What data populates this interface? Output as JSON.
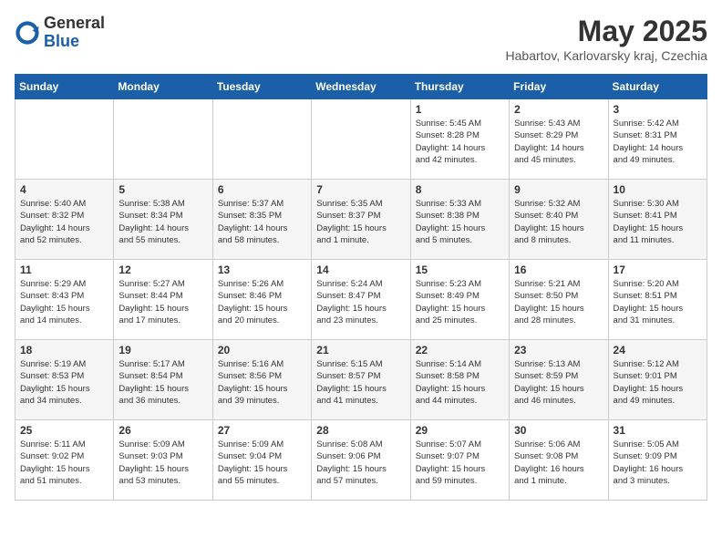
{
  "header": {
    "logo_general": "General",
    "logo_blue": "Blue",
    "month_title": "May 2025",
    "location": "Habartov, Karlovarsky kraj, Czechia"
  },
  "days_of_week": [
    "Sunday",
    "Monday",
    "Tuesday",
    "Wednesday",
    "Thursday",
    "Friday",
    "Saturday"
  ],
  "weeks": [
    [
      {
        "date": "",
        "info": ""
      },
      {
        "date": "",
        "info": ""
      },
      {
        "date": "",
        "info": ""
      },
      {
        "date": "",
        "info": ""
      },
      {
        "date": "1",
        "info": "Sunrise: 5:45 AM\nSunset: 8:28 PM\nDaylight: 14 hours\nand 42 minutes."
      },
      {
        "date": "2",
        "info": "Sunrise: 5:43 AM\nSunset: 8:29 PM\nDaylight: 14 hours\nand 45 minutes."
      },
      {
        "date": "3",
        "info": "Sunrise: 5:42 AM\nSunset: 8:31 PM\nDaylight: 14 hours\nand 49 minutes."
      }
    ],
    [
      {
        "date": "4",
        "info": "Sunrise: 5:40 AM\nSunset: 8:32 PM\nDaylight: 14 hours\nand 52 minutes."
      },
      {
        "date": "5",
        "info": "Sunrise: 5:38 AM\nSunset: 8:34 PM\nDaylight: 14 hours\nand 55 minutes."
      },
      {
        "date": "6",
        "info": "Sunrise: 5:37 AM\nSunset: 8:35 PM\nDaylight: 14 hours\nand 58 minutes."
      },
      {
        "date": "7",
        "info": "Sunrise: 5:35 AM\nSunset: 8:37 PM\nDaylight: 15 hours\nand 1 minute."
      },
      {
        "date": "8",
        "info": "Sunrise: 5:33 AM\nSunset: 8:38 PM\nDaylight: 15 hours\nand 5 minutes."
      },
      {
        "date": "9",
        "info": "Sunrise: 5:32 AM\nSunset: 8:40 PM\nDaylight: 15 hours\nand 8 minutes."
      },
      {
        "date": "10",
        "info": "Sunrise: 5:30 AM\nSunset: 8:41 PM\nDaylight: 15 hours\nand 11 minutes."
      }
    ],
    [
      {
        "date": "11",
        "info": "Sunrise: 5:29 AM\nSunset: 8:43 PM\nDaylight: 15 hours\nand 14 minutes."
      },
      {
        "date": "12",
        "info": "Sunrise: 5:27 AM\nSunset: 8:44 PM\nDaylight: 15 hours\nand 17 minutes."
      },
      {
        "date": "13",
        "info": "Sunrise: 5:26 AM\nSunset: 8:46 PM\nDaylight: 15 hours\nand 20 minutes."
      },
      {
        "date": "14",
        "info": "Sunrise: 5:24 AM\nSunset: 8:47 PM\nDaylight: 15 hours\nand 23 minutes."
      },
      {
        "date": "15",
        "info": "Sunrise: 5:23 AM\nSunset: 8:49 PM\nDaylight: 15 hours\nand 25 minutes."
      },
      {
        "date": "16",
        "info": "Sunrise: 5:21 AM\nSunset: 8:50 PM\nDaylight: 15 hours\nand 28 minutes."
      },
      {
        "date": "17",
        "info": "Sunrise: 5:20 AM\nSunset: 8:51 PM\nDaylight: 15 hours\nand 31 minutes."
      }
    ],
    [
      {
        "date": "18",
        "info": "Sunrise: 5:19 AM\nSunset: 8:53 PM\nDaylight: 15 hours\nand 34 minutes."
      },
      {
        "date": "19",
        "info": "Sunrise: 5:17 AM\nSunset: 8:54 PM\nDaylight: 15 hours\nand 36 minutes."
      },
      {
        "date": "20",
        "info": "Sunrise: 5:16 AM\nSunset: 8:56 PM\nDaylight: 15 hours\nand 39 minutes."
      },
      {
        "date": "21",
        "info": "Sunrise: 5:15 AM\nSunset: 8:57 PM\nDaylight: 15 hours\nand 41 minutes."
      },
      {
        "date": "22",
        "info": "Sunrise: 5:14 AM\nSunset: 8:58 PM\nDaylight: 15 hours\nand 44 minutes."
      },
      {
        "date": "23",
        "info": "Sunrise: 5:13 AM\nSunset: 8:59 PM\nDaylight: 15 hours\nand 46 minutes."
      },
      {
        "date": "24",
        "info": "Sunrise: 5:12 AM\nSunset: 9:01 PM\nDaylight: 15 hours\nand 49 minutes."
      }
    ],
    [
      {
        "date": "25",
        "info": "Sunrise: 5:11 AM\nSunset: 9:02 PM\nDaylight: 15 hours\nand 51 minutes."
      },
      {
        "date": "26",
        "info": "Sunrise: 5:09 AM\nSunset: 9:03 PM\nDaylight: 15 hours\nand 53 minutes."
      },
      {
        "date": "27",
        "info": "Sunrise: 5:09 AM\nSunset: 9:04 PM\nDaylight: 15 hours\nand 55 minutes."
      },
      {
        "date": "28",
        "info": "Sunrise: 5:08 AM\nSunset: 9:06 PM\nDaylight: 15 hours\nand 57 minutes."
      },
      {
        "date": "29",
        "info": "Sunrise: 5:07 AM\nSunset: 9:07 PM\nDaylight: 15 hours\nand 59 minutes."
      },
      {
        "date": "30",
        "info": "Sunrise: 5:06 AM\nSunset: 9:08 PM\nDaylight: 16 hours\nand 1 minute."
      },
      {
        "date": "31",
        "info": "Sunrise: 5:05 AM\nSunset: 9:09 PM\nDaylight: 16 hours\nand 3 minutes."
      }
    ]
  ]
}
